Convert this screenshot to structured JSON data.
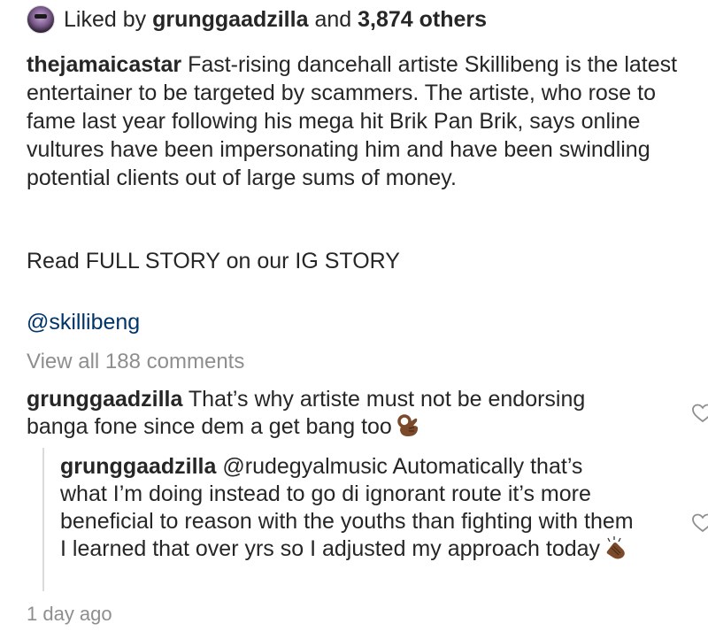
{
  "likes": {
    "prefix": "Liked by",
    "user": "grunggaadzilla",
    "conjunction": "and",
    "count": "3,874 others"
  },
  "caption": {
    "username": "thejamaicastar",
    "text": "Fast-rising dancehall artiste Skillibeng is the latest entertainer to be targeted by scammers. The artiste, who rose to fame last year following his mega hit Brik Pan Brik, says online vultures have been impersonating him and have been swindling potential clients out of large sums of money.",
    "read_more": "Read FULL STORY on our IG STORY",
    "mention": "@skillibeng"
  },
  "view_all_comments": "View all 188 comments",
  "comments": [
    {
      "username": "grunggaadzilla",
      "text": "That’s why artiste must not be endorsing banga fone since dem a get bang too",
      "emoji": "ok-hand-emoji"
    }
  ],
  "reply": {
    "username": "grunggaadzilla",
    "mention": "@rudegyalmusic",
    "text": "Automatically that’s what I’m doing instead to go di ignorant route it’s more beneficial to reason with the youths than fighting with them I learned that over yrs so I adjusted my approach today",
    "emoji": "clapping-hands-emoji"
  },
  "timestamp": "1 day ago",
  "colors": {
    "text": "#262626",
    "link": "#003569",
    "muted": "#8e8e8e",
    "divider": "#dbdbdb",
    "emoji_skin": "#7a4a2a"
  },
  "icons": [
    "avatar",
    "heart-icon",
    "ok-hand-emoji",
    "clapping-hands-emoji"
  ]
}
